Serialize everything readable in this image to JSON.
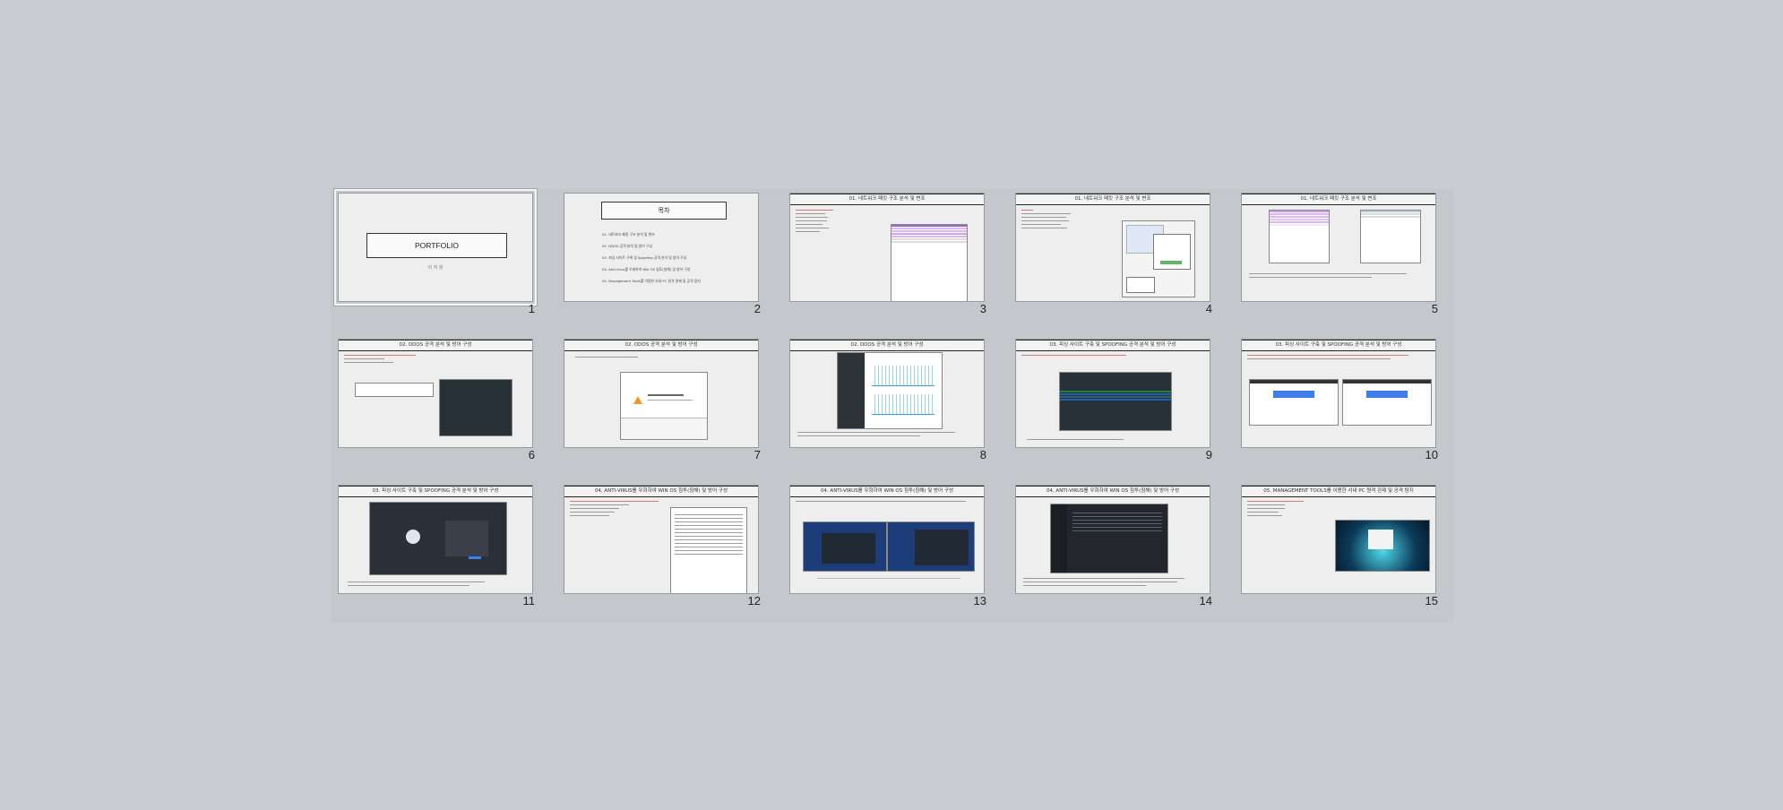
{
  "slides": [
    {
      "num": "1",
      "title": "PORTFOLIO",
      "author": "이 지 원",
      "selected": true
    },
    {
      "num": "2",
      "title": "목차",
      "toc": [
        "01. 네트워크 패킷 구조 분석 및 변조",
        "02. DDOS 공격 분석 및 방어 구성",
        "03. 피싱 사이트 구축 및 Spoofing 공격 분석 및 방어 구성",
        "04. Anti-Virus를 우회하여 Win OS 침투(침해) 및 방어 구성",
        "05. Management Tools를 이용한 사내 PC 원격 관제 및 공격 탐지"
      ]
    },
    {
      "num": "3",
      "title": "01. 네트워크 패킷 구조 분석 및 변조"
    },
    {
      "num": "4",
      "title": "01. 네트워크 패킷 구조 분석 및 변조"
    },
    {
      "num": "5",
      "title": "01. 네트워크 패킷 구조 분석 및 변조"
    },
    {
      "num": "6",
      "title": "02. DDOS 공격 분석 및 방어 구성"
    },
    {
      "num": "7",
      "title": "02. DDOS 공격 분석 및 방어 구성"
    },
    {
      "num": "8",
      "title": "02. DDOS 공격 분석 및 방어 구성"
    },
    {
      "num": "9",
      "title": "03. 피싱 사이트 구축 및 SPOOFING 공격 분석 및 방어 구성"
    },
    {
      "num": "10",
      "title": "03. 피싱 사이트 구축 및 SPOOFING 공격 분석 및 방어 구성"
    },
    {
      "num": "11",
      "title": "03. 피싱 사이트 구축 및 SPOOFING 공격 분석 및 방어 구성"
    },
    {
      "num": "12",
      "title": "04. ANTI-VIRUS를 우회하여 WIN OS 침투(침해) 및 방어 구성"
    },
    {
      "num": "13",
      "title": "04. ANTI-VIRUS를 우회하여 WIN OS 침투(침해) 및 방어 구성"
    },
    {
      "num": "14",
      "title": "04. ANTI-VIRUS를 우회하여 WIN OS 침투(침해) 및 방어 구성"
    },
    {
      "num": "15",
      "title": "05. MANAGEMENT TOOLS를 이용한 사내 PC 원격 관제 및 공격 탐지"
    }
  ],
  "colors": {
    "workspace": "#c9ccd0",
    "slide_bg": "#eeeeee",
    "accent": "#d01818"
  }
}
